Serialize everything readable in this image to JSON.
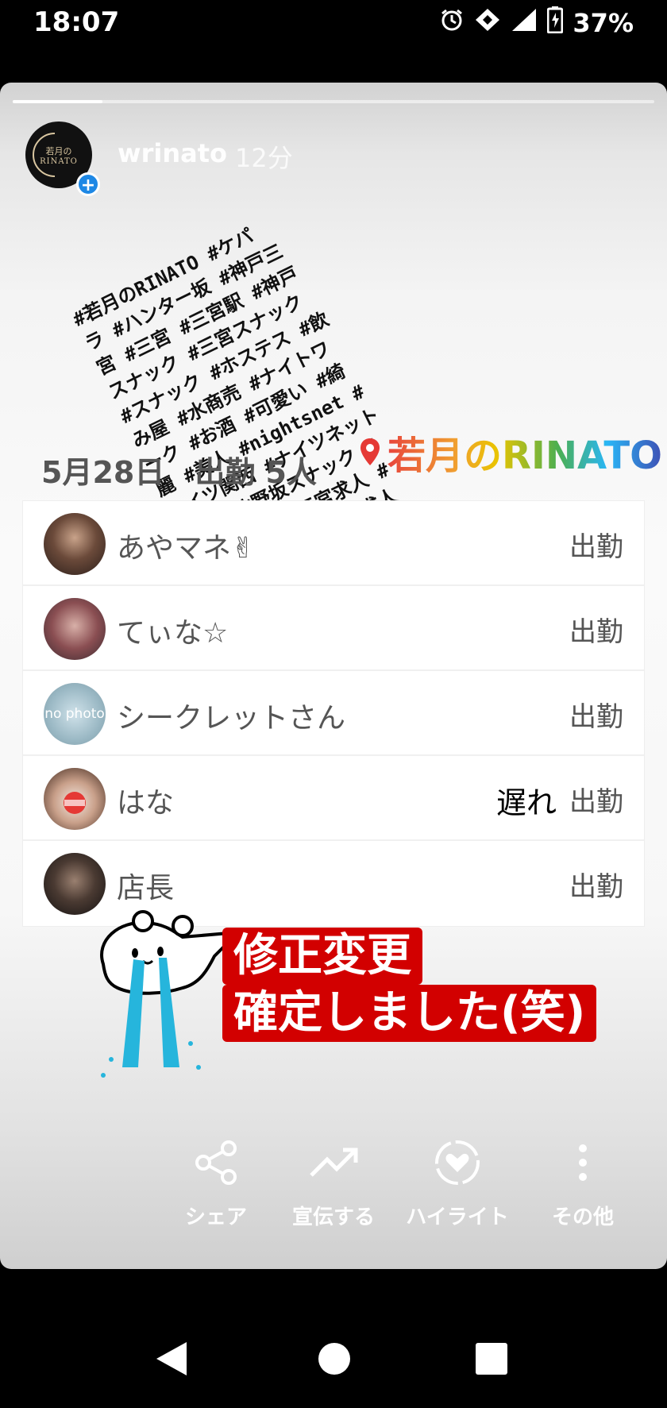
{
  "status_bar": {
    "time": "18:07",
    "battery": "37%"
  },
  "story": {
    "progress_fraction": 0.14,
    "account_logo_line1": "若月の",
    "account_logo_line2": "RINATO",
    "username": "wrinato",
    "posted_ago": "12分",
    "hashtags": "#若月のRINATO #ケパ\nラ #ハンター坂 #神戸三\n宮 #三宮 #三宮駅 #神戸\nスナック #三宮スナック\n#スナック #ホステス #飲\nみ屋 #水商売 #ナイトワ\nーク #お酒 #可愛い #綺\n麗 #美人 #nightsnet #\nナイツ関西 #ナイツネット\n関西 #北野坂スナック #\n女の子募集 #三宮求人 #\n神戸求人 #スナック求人",
    "date_heading": "5月28日　出勤 5人",
    "location": "若月のRINATO",
    "staff": [
      {
        "name": "あやマネ✌",
        "status": "出勤",
        "late": ""
      },
      {
        "name": "てぃな☆",
        "status": "出勤",
        "late": ""
      },
      {
        "name": "シークレットさん",
        "status": "出勤",
        "late": "",
        "avatar_text": "no photo"
      },
      {
        "name": "はな",
        "status": "出勤",
        "late": "遅れ"
      },
      {
        "name": "店長",
        "status": "出勤",
        "late": ""
      }
    ],
    "banner_line1": "修正変更",
    "banner_line2": "確定しました(笑)",
    "banner_color": "#d20000",
    "actions": [
      {
        "label": "シェア",
        "icon": "share-icon"
      },
      {
        "label": "宣伝する",
        "icon": "trending-up-icon"
      },
      {
        "label": "ハイライト",
        "icon": "highlight-heart-icon"
      },
      {
        "label": "その他",
        "icon": "more-vertical-icon"
      }
    ]
  }
}
